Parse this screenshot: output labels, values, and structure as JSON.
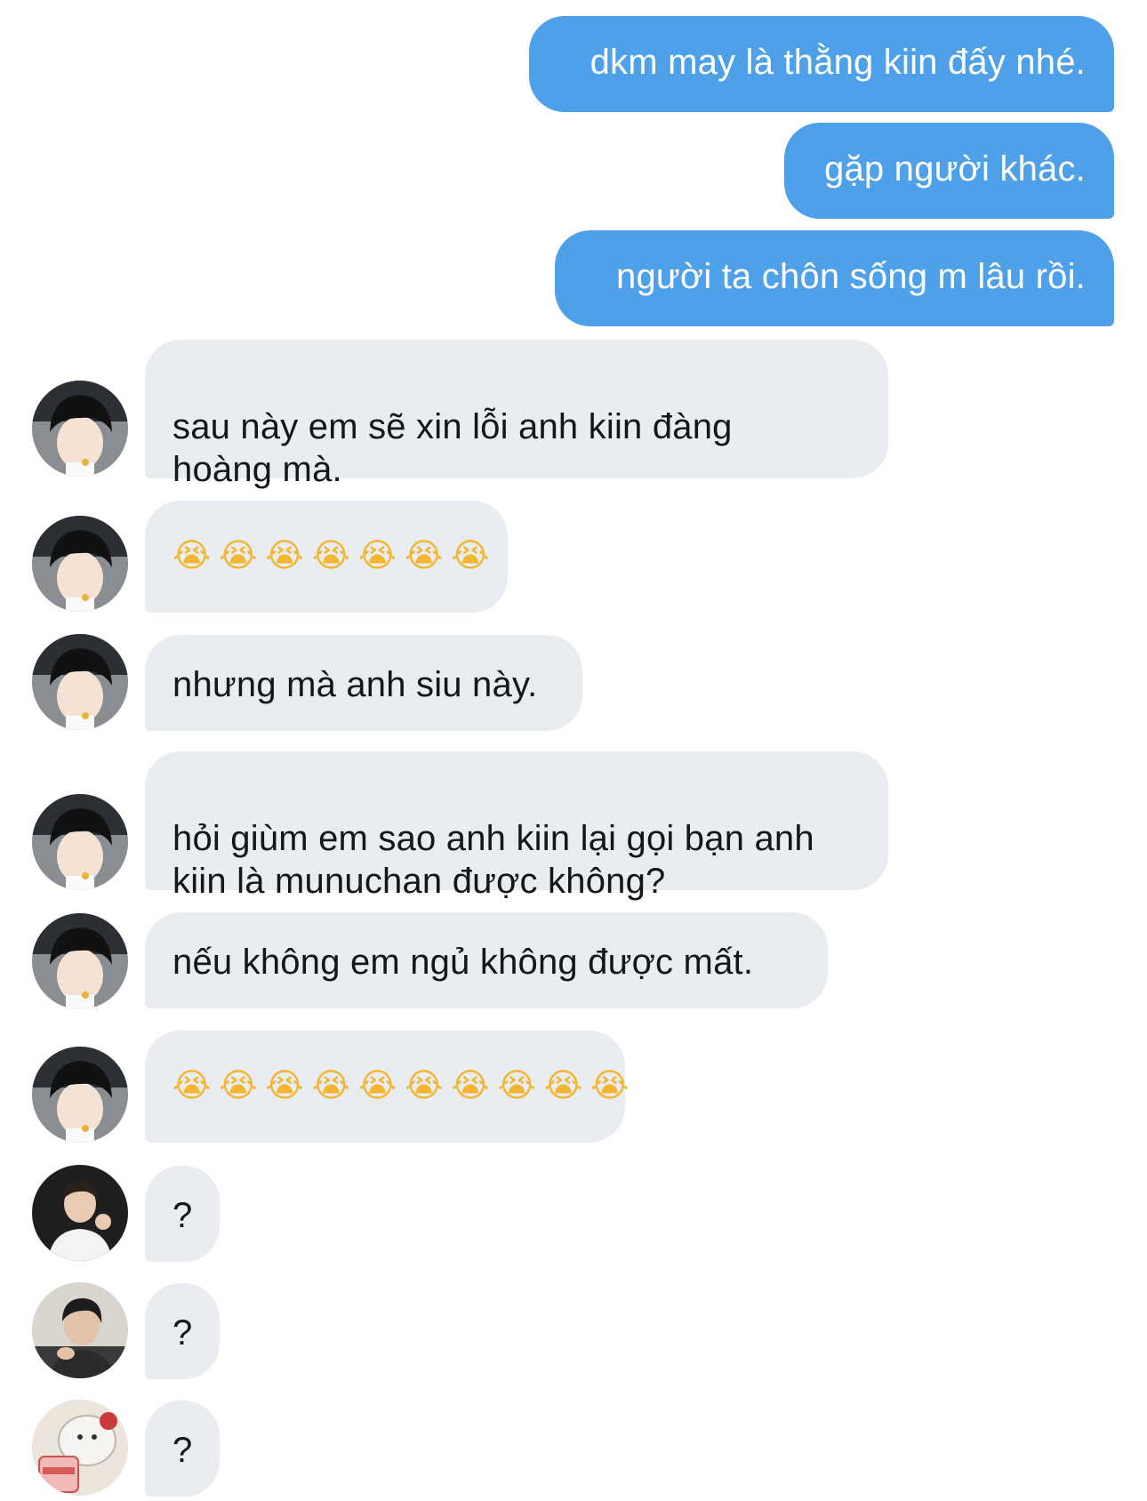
{
  "conversation": {
    "sent": [
      {
        "text": "dkm may là thằng kiin đấy nhé."
      },
      {
        "text": "gặp người khác."
      },
      {
        "text": "người ta chôn sống m lâu rồi."
      }
    ],
    "received": [
      {
        "text": "sau này em sẽ xin lỗi anh kiin đàng\nhoàng mà.",
        "avatar": "dark-haired-person-avatar"
      },
      {
        "text": "😭😭😭😭😭😭😭",
        "avatar": "dark-haired-person-avatar"
      },
      {
        "text": "nhưng mà anh siu này.",
        "avatar": "dark-haired-person-avatar"
      },
      {
        "text": "hỏi giùm em sao anh kiin lại gọi bạn anh\nkiin là munuchan được không?",
        "avatar": "dark-haired-person-avatar"
      },
      {
        "text": "nếu không em ngủ không được mất.",
        "avatar": "dark-haired-person-avatar"
      },
      {
        "text": "😭😭😭😭😭😭😭😭😭😭",
        "avatar": "dark-haired-person-avatar"
      },
      {
        "text": "?",
        "avatar": "person-waving-avatar"
      },
      {
        "text": "?",
        "avatar": "person-eating-avatar"
      },
      {
        "text": "?",
        "avatar": "bear-ice-cream-avatar"
      }
    ]
  },
  "colors": {
    "sent_bubble": "#4ea0e8",
    "received_bubble": "#e9ecf0",
    "sent_text": "#ffffff",
    "received_text": "#14171a",
    "emoji": "#f2b632"
  }
}
